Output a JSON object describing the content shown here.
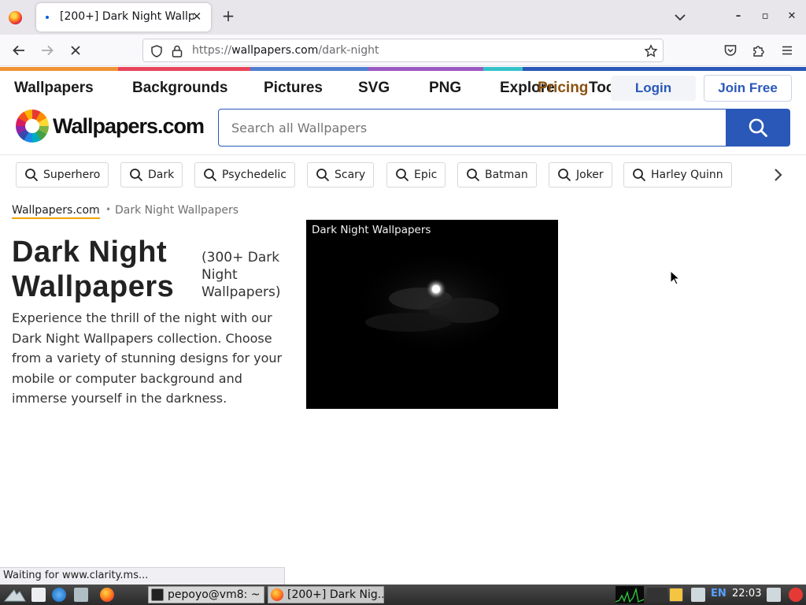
{
  "browser": {
    "tab_title": "[200+] Dark Night Wallp",
    "tab_close": "✕",
    "new_tab": "+",
    "url_scheme": "https://",
    "url_host": "wallpapers.com",
    "url_path": "/dark-night",
    "win_min": "–",
    "win_max": "▫",
    "win_close": "✕"
  },
  "site": {
    "nav": [
      "Wallpapers",
      "Backgrounds",
      "Pictures",
      "SVG",
      "PNG",
      "Explore"
    ],
    "overlap_nav": [
      "Pricing",
      "Too"
    ],
    "login": "Login",
    "join": "Join Free",
    "logo": "Wallpapers.com",
    "search_placeholder": "Search all Wallpapers",
    "stripe_colors": [
      "#f19334",
      "#e8455c",
      "#4f7fd0",
      "#9b59c2",
      "#35c2c9",
      "#2a58b8"
    ]
  },
  "chips": [
    "Superhero",
    "Dark",
    "Psychedelic",
    "Scary",
    "Epic",
    "Batman",
    "Joker",
    "Harley Quinn"
  ],
  "breadcrumb": {
    "home": "Wallpapers.com",
    "sep": "•",
    "current": "Dark Night Wallpapers"
  },
  "page": {
    "title": "Dark Night Wallpapers",
    "count": "(300+ Dark Night Wallpapers)",
    "description": "Experience the thrill of the night with our Dark Night Wallpapers collection. Choose from a variety of stunning designs for your mobile or computer background and immerse yourself in the darkness.",
    "card_title": "Dark Night Wallpapers"
  },
  "status": "Waiting for www.clarity.ms...",
  "taskbar": {
    "terminal": "pepoyo@vm8: ~",
    "firefox": "[200+] Dark Nig...",
    "lang": "EN",
    "clock": "22:03"
  }
}
